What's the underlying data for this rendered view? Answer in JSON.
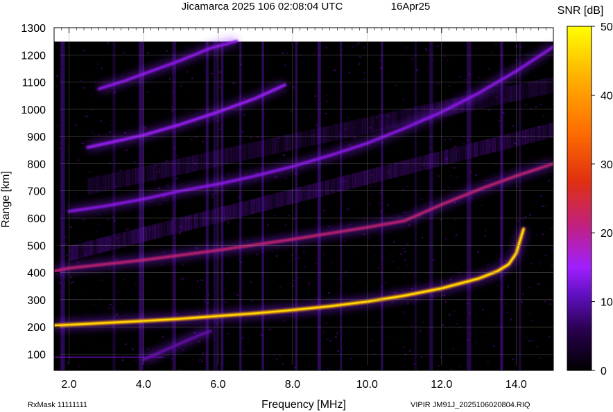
{
  "chart_data": {
    "type": "heatmap",
    "title": "Jicamarca 2025 106 02:08:04 UTC",
    "date_label": "16Apr25",
    "xlabel": "Frequency [MHz]",
    "ylabel": "Range [km]",
    "xlim": [
      1.6,
      15.0
    ],
    "ylim": [
      40,
      1300
    ],
    "x_ticks": [
      "2.0",
      "4.0",
      "6.0",
      "8.0",
      "10.0",
      "12.0",
      "14.0"
    ],
    "x_tick_values": [
      2.0,
      4.0,
      6.0,
      8.0,
      10.0,
      12.0,
      14.0
    ],
    "y_ticks": [
      "100",
      "200",
      "300",
      "400",
      "500",
      "600",
      "700",
      "800",
      "900",
      "1000",
      "1100",
      "1200",
      "1300"
    ],
    "y_tick_values": [
      100,
      200,
      300,
      400,
      500,
      600,
      700,
      800,
      900,
      1000,
      1100,
      1200,
      1300
    ],
    "grid": true,
    "colorbar": {
      "label": "SNR [dB]",
      "range": [
        0,
        50
      ],
      "ticks": [
        "0",
        "10",
        "20",
        "30",
        "40",
        "50"
      ],
      "tick_values": [
        0,
        10,
        20,
        30,
        40,
        50
      ],
      "colormap": [
        "#000000",
        "#3a0060",
        "#7a10d0",
        "#a020ff",
        "#c02070",
        "#e04010",
        "#ff8000",
        "#ffc000",
        "#ffff00"
      ]
    },
    "traces": [
      {
        "name_hidden": "F-region 1st hop",
        "x": [
          1.6,
          2.0,
          3.0,
          4.0,
          5.0,
          6.0,
          7.0,
          8.0,
          9.0,
          10.0,
          11.0,
          12.0,
          13.0,
          13.5,
          13.8,
          14.0,
          14.2
        ],
        "y": [
          205,
          208,
          215,
          222,
          230,
          240,
          250,
          262,
          276,
          293,
          315,
          342,
          378,
          405,
          430,
          470,
          560
        ],
        "snr": 42
      },
      {
        "name_hidden": "F-region 2nd hop",
        "x": [
          1.6,
          2.0,
          4.0,
          6.0,
          8.0,
          10.0,
          11.0,
          12.0,
          13.0,
          14.0,
          15.0
        ],
        "y": [
          405,
          416,
          446,
          482,
          522,
          566,
          590,
          650,
          705,
          755,
          800
        ],
        "snr": 25
      },
      {
        "name_hidden": "F-region 3rd hop",
        "x": [
          2.0,
          3.0,
          4.0,
          5.0,
          6.0,
          7.0,
          8.0,
          9.0,
          10.0,
          11.0,
          12.0,
          13.0,
          14.0,
          15.0
        ],
        "y": [
          625,
          645,
          670,
          700,
          725,
          755,
          790,
          830,
          875,
          930,
          990,
          1060,
          1140,
          1230
        ],
        "snr": 15
      },
      {
        "name_hidden": "F-region 4th hop",
        "x": [
          2.5,
          3.0,
          4.0,
          5.0,
          6.0,
          7.0,
          7.8
        ],
        "y": [
          860,
          875,
          905,
          945,
          990,
          1040,
          1090
        ],
        "snr": 18
      },
      {
        "name_hidden": "F-region 5th hop",
        "x": [
          2.8,
          3.5,
          4.0,
          5.0,
          5.8,
          6.5
        ],
        "y": [
          1075,
          1105,
          1130,
          1180,
          1225,
          1250
        ],
        "snr": 16
      },
      {
        "name_hidden": "E-region echo",
        "x": [
          1.6,
          2.0,
          3.0,
          4.0,
          4.5
        ],
        "y": [
          88,
          88,
          88,
          88,
          90
        ],
        "snr": 12
      },
      {
        "name_hidden": "oblique low trace",
        "x": [
          4.0,
          4.5,
          5.0,
          5.5,
          5.8
        ],
        "y": [
          80,
          110,
          140,
          170,
          185
        ],
        "snr": 10
      }
    ],
    "vertical_interference_mhz": [
      1.8,
      3.2,
      3.9,
      4.8,
      5.7,
      5.9,
      6.1,
      6.6,
      7.2,
      8.1,
      8.7,
      9.3,
      10.4,
      11.3,
      11.7,
      12.7,
      13.6,
      14.1
    ]
  },
  "footer": {
    "rx_mask": "RxMask 11111111",
    "station_file": "VIPIR  JM91J_2025106020804.RIQ"
  }
}
